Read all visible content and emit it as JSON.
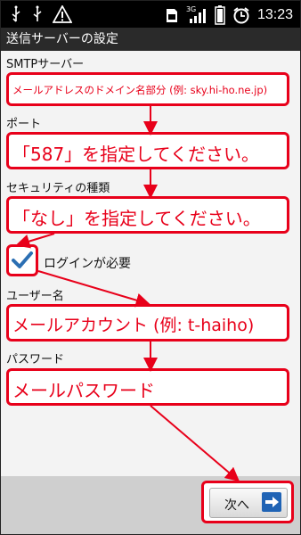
{
  "status_bar": {
    "network": "3G",
    "time": "13:23",
    "icons": [
      "usb-icon",
      "usb-icon",
      "warning-icon",
      "sd-card-icon",
      "signal-icon",
      "battery-icon",
      "alarm-clock-icon"
    ]
  },
  "title_bar": {
    "title": "送信サーバーの設定"
  },
  "fields": {
    "smtp_label": "SMTPサーバー",
    "smtp_value": "メールアドレスのドメイン名部分 (例: sky.hi-ho.ne.jp)",
    "port_label": "ポート",
    "port_value": "「587」を指定してください。",
    "security_label": "セキュリティの種類",
    "security_value": "「なし」を指定してください。",
    "login_label": "ログインが必要",
    "login_checked": true,
    "username_label": "ユーザー名",
    "username_value": "メールアカウント (例: t-haiho)",
    "password_label": "パスワード",
    "password_value": "メールパスワード"
  },
  "bottom": {
    "next_label": "次へ"
  },
  "colors": {
    "annotation": "#e8001a",
    "accent": "#1f63b5"
  }
}
